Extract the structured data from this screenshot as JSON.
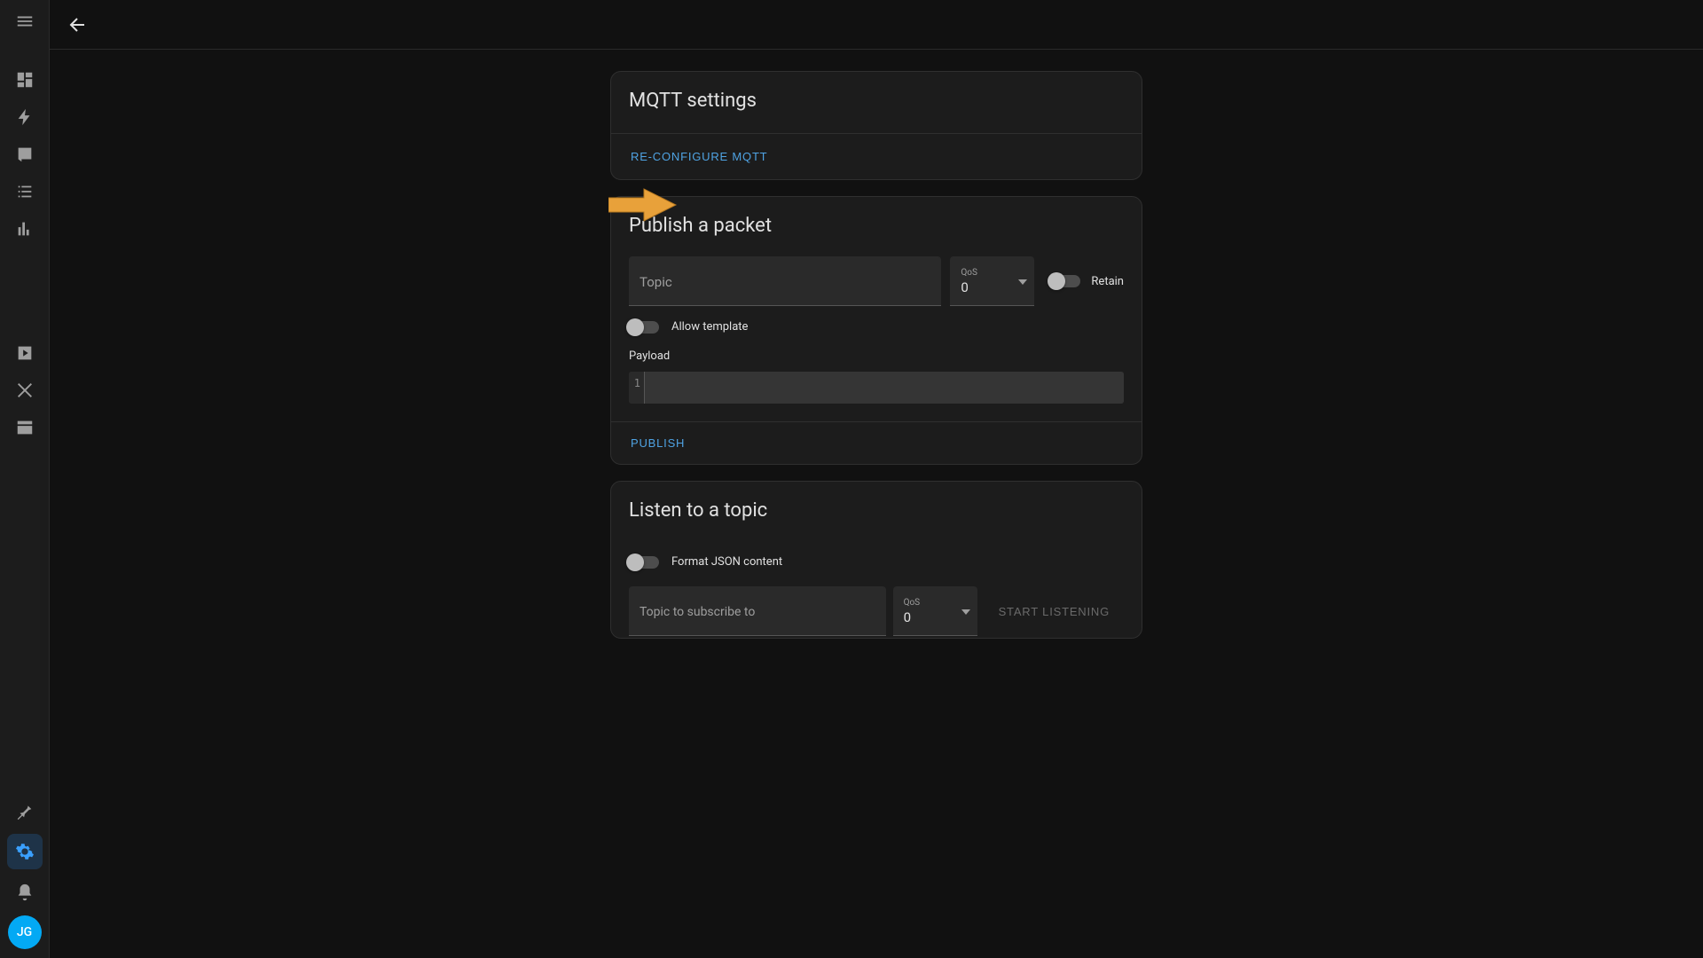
{
  "sidebar": {
    "avatar_initials": "JG"
  },
  "settings_card": {
    "title": "MQTT settings",
    "reconfigure_label": "Re-configure MQTT"
  },
  "publish_card": {
    "title": "Publish a packet",
    "topic_label": "Topic",
    "topic_value": "",
    "qos_label": "QoS",
    "qos_value": "0",
    "retain_label": "Retain",
    "allow_template_label": "Allow template",
    "payload_label": "Payload",
    "payload_line_no": "1",
    "payload_value": "",
    "publish_button": "Publish"
  },
  "listen_card": {
    "title": "Listen to a topic",
    "format_json_label": "Format JSON content",
    "subscribe_label": "Topic to subscribe to",
    "subscribe_value": "",
    "qos_label": "QoS",
    "qos_value": "0",
    "start_button": "Start listening"
  }
}
